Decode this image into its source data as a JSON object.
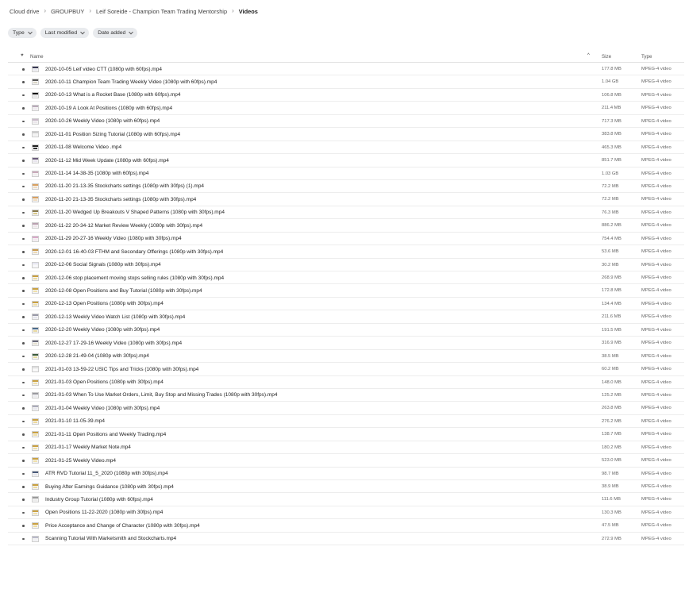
{
  "breadcrumb": [
    "Cloud drive",
    "GROUPBUY",
    "Leif Soreide - Champion Team Trading Mentorship",
    "Videos"
  ],
  "filters": [
    "Type",
    "Last modified",
    "Date added"
  ],
  "columns": {
    "name": "Name",
    "size": "Size",
    "type": "Type"
  },
  "files": [
    {
      "name": "2020-10-05 Leif video CTT (1080p with 60fps).mp4",
      "size": "177.8 MB",
      "type": "MPEG-4 video",
      "tbar": "#3a3a55",
      "tbody": "#e8e8f0"
    },
    {
      "name": "2020-10-11 Champion Team Trading Weekly Video (1080p with 60fps).mp4",
      "size": "1.04 GB",
      "type": "MPEG-4 video",
      "tbar": "#5a5a5a",
      "tbody": "#d9d4c4"
    },
    {
      "name": "2020-10-13 What is a Rocket Base (1080p with 60fps).mp4",
      "size": "106.8 MB",
      "type": "MPEG-4 video",
      "tbar": "#111111",
      "tbody": "#e6e6e6"
    },
    {
      "name": "2020-10-19 A Look At Positions (1080p with 60fps).mp4",
      "size": "211.4 MB",
      "type": "MPEG-4 video",
      "tbar": "#b9a9b9",
      "tbody": "#f0eaf0"
    },
    {
      "name": "2020-10-26 Weekly Video (1080p with 60fps).mp4",
      "size": "717.3 MB",
      "type": "MPEG-4 video",
      "tbar": "#c9b9c9",
      "tbody": "#ece6ec"
    },
    {
      "name": "2020-11-01 Position Sizing Tutorial (1080p with 60fps).mp4",
      "size": "383.8 MB",
      "type": "MPEG-4 video",
      "tbar": "#cccccc",
      "tbody": "#f2f2f2"
    },
    {
      "name": "2020-11-08 Welcome Video .mp4",
      "size": "465.3 MB",
      "type": "MPEG-4 video",
      "tbar": "#222222",
      "tbody": "#333333"
    },
    {
      "name": "2020-11-12 Mid Week Update (1080p with 60fps).mp4",
      "size": "851.7 MB",
      "type": "MPEG-4 video",
      "tbar": "#6a5a7a",
      "tbody": "#e8e4ee"
    },
    {
      "name": "2020-11-14 14-38-35 (1080p with 60fps).mp4",
      "size": "1.03 GB",
      "type": "MPEG-4 video",
      "tbar": "#c9a9b9",
      "tbody": "#f2ecef"
    },
    {
      "name": "2020-11-20 21-13-35 Stockcharts settings (1080p with 30fps) (1).mp4",
      "size": "72.2 MB",
      "type": "MPEG-4 video",
      "tbar": "#d9a060",
      "tbody": "#f0dcc0"
    },
    {
      "name": "2020-11-20 21-13-35 Stockcharts settings (1080p with 30fps).mp4",
      "size": "72.2 MB",
      "type": "MPEG-4 video",
      "tbar": "#d9a060",
      "tbody": "#f0dcc0"
    },
    {
      "name": "2020-11-20 Wedged Up Breakouts V Shaped Patterns (1080p with 30fps).mp4",
      "size": "76.3 MB",
      "type": "MPEG-4 video",
      "tbar": "#8a7a4a",
      "tbody": "#d9c98a"
    },
    {
      "name": "2020-11-22 20-34-12 Market Review Weekly (1080p with 30fps).mp4",
      "size": "886.2 MB",
      "type": "MPEG-4 video",
      "tbar": "#b9a0b0",
      "tbody": "#efe4ea"
    },
    {
      "name": "2020-11-29 20-27-16 Weekly Video (1080p with 30fps).mp4",
      "size": "754.4 MB",
      "type": "MPEG-4 video",
      "tbar": "#d9a9c9",
      "tbody": "#f4e6ef"
    },
    {
      "name": "2020-12-01 16-40-03 FTHM and Secondary Offerings (1080p with 30fps).mp4",
      "size": "53.6 MB",
      "type": "MPEG-4 video",
      "tbar": "#c99a50",
      "tbody": "#ecd8b4"
    },
    {
      "name": "2020-12-06 Social Signals (1080p with 30fps).mp4",
      "size": "30.2 MB",
      "type": "MPEG-4 video",
      "tbar": "#e6e6f2",
      "tbody": "#f8f8fc"
    },
    {
      "name": "2020-12-06 stop placement moving stops selling rules (1080p with 30fps).mp4",
      "size": "268.9 MB",
      "type": "MPEG-4 video",
      "tbar": "#c9a040",
      "tbody": "#eedca0"
    },
    {
      "name": "2020-12-08 Open Positions and Buy Tutorial (1080p with 30fps).mp4",
      "size": "172.8 MB",
      "type": "MPEG-4 video",
      "tbar": "#c9a040",
      "tbody": "#f0e0a8"
    },
    {
      "name": "2020-12-13 Open Positions (1080p with 30fps).mp4",
      "size": "134.4 MB",
      "type": "MPEG-4 video",
      "tbar": "#c9a040",
      "tbody": "#f0e0a8"
    },
    {
      "name": "2020-12-13 Weekly Video Watch List (1080p with 30fps).mp4",
      "size": "211.6 MB",
      "type": "MPEG-4 video",
      "tbar": "#9a9aa9",
      "tbody": "#e4e4ee"
    },
    {
      "name": "2020-12-20 Weekly Video (1080p with 30fps).mp4",
      "size": "191.5 MB",
      "type": "MPEG-4 video",
      "tbar": "#4a6a8a",
      "tbody": "#e8d9a0"
    },
    {
      "name": "2020-12-27 17-29-16 Weekly Video (1080p with 30fps).mp4",
      "size": "316.9 MB",
      "type": "MPEG-4 video",
      "tbar": "#6a6a7a",
      "tbody": "#e6e2d0"
    },
    {
      "name": "2020-12-28 21-49-04 (1080p with 30fps).mp4",
      "size": "38.5 MB",
      "type": "MPEG-4 video",
      "tbar": "#3a5a3a",
      "tbody": "#e6dca0"
    },
    {
      "name": "2021-01-03 13-59-22 USIC Tips and Tricks (1080p with 30fps).mp4",
      "size": "60.2 MB",
      "type": "MPEG-4 video",
      "tbar": "#e0e0e0",
      "tbody": "#fafafa"
    },
    {
      "name": "2021-01-03 Open Positions (1080p with 30fps).mp4",
      "size": "148.0 MB",
      "type": "MPEG-4 video",
      "tbar": "#c9a040",
      "tbody": "#f0e0a8"
    },
    {
      "name": "2021-01-03 When To Use Market Orders, Limit, Buy Stop and Missing Trades (1080p with 30fps).mp4",
      "size": "125.2 MB",
      "type": "MPEG-4 video",
      "tbar": "#9a9aa0",
      "tbody": "#ececf0"
    },
    {
      "name": "2021-01-04 Weekly Video (1080p with 30fps).mp4",
      "size": "263.8 MB",
      "type": "MPEG-4 video",
      "tbar": "#aaaab9",
      "tbody": "#e8e8ef"
    },
    {
      "name": "2021-01-10 11-05-39.mp4",
      "size": "276.2 MB",
      "type": "MPEG-4 video",
      "tbar": "#c9a040",
      "tbody": "#ecd89a"
    },
    {
      "name": "2021-01-11 Open Positions and Weekly Trading.mp4",
      "size": "138.7 MB",
      "type": "MPEG-4 video",
      "tbar": "#c9a040",
      "tbody": "#f0e0a8"
    },
    {
      "name": "2021-01-17 Weekly Market Note.mp4",
      "size": "180.2 MB",
      "type": "MPEG-4 video",
      "tbar": "#c9a040",
      "tbody": "#f0e0a8"
    },
    {
      "name": "2021-01-25 Weekly Video.mp4",
      "size": "523.0 MB",
      "type": "MPEG-4 video",
      "tbar": "#c9a040",
      "tbody": "#f0e0a8"
    },
    {
      "name": "ATR RVD Tutorial 11_5_2020 (1080p with 30fps).mp4",
      "size": "98.7 MB",
      "type": "MPEG-4 video",
      "tbar": "#4a5a7a",
      "tbody": "#e6e6ee"
    },
    {
      "name": "Buying After Earnings Guidance (1080p with 30fps).mp4",
      "size": "38.9 MB",
      "type": "MPEG-4 video",
      "tbar": "#c9a040",
      "tbody": "#eedca0"
    },
    {
      "name": "Industry Group Tutorial (1080p with 60fps).mp4",
      "size": "111.6 MB",
      "type": "MPEG-4 video",
      "tbar": "#9a9a9a",
      "tbody": "#ececec"
    },
    {
      "name": "Open Positions 11-22-2020 (1080p with 30fps).mp4",
      "size": "130.3 MB",
      "type": "MPEG-4 video",
      "tbar": "#c9a040",
      "tbody": "#f0e0a8"
    },
    {
      "name": "Price Acceptance and Change of Character (1080p with 30fps).mp4",
      "size": "47.5 MB",
      "type": "MPEG-4 video",
      "tbar": "#c9a040",
      "tbody": "#eedca0"
    },
    {
      "name": "Scanning Tutorial With Marketsmith and Stockcharts.mp4",
      "size": "272.9 MB",
      "type": "MPEG-4 video",
      "tbar": "#b9b9c9",
      "tbody": "#f0f0f4"
    }
  ]
}
